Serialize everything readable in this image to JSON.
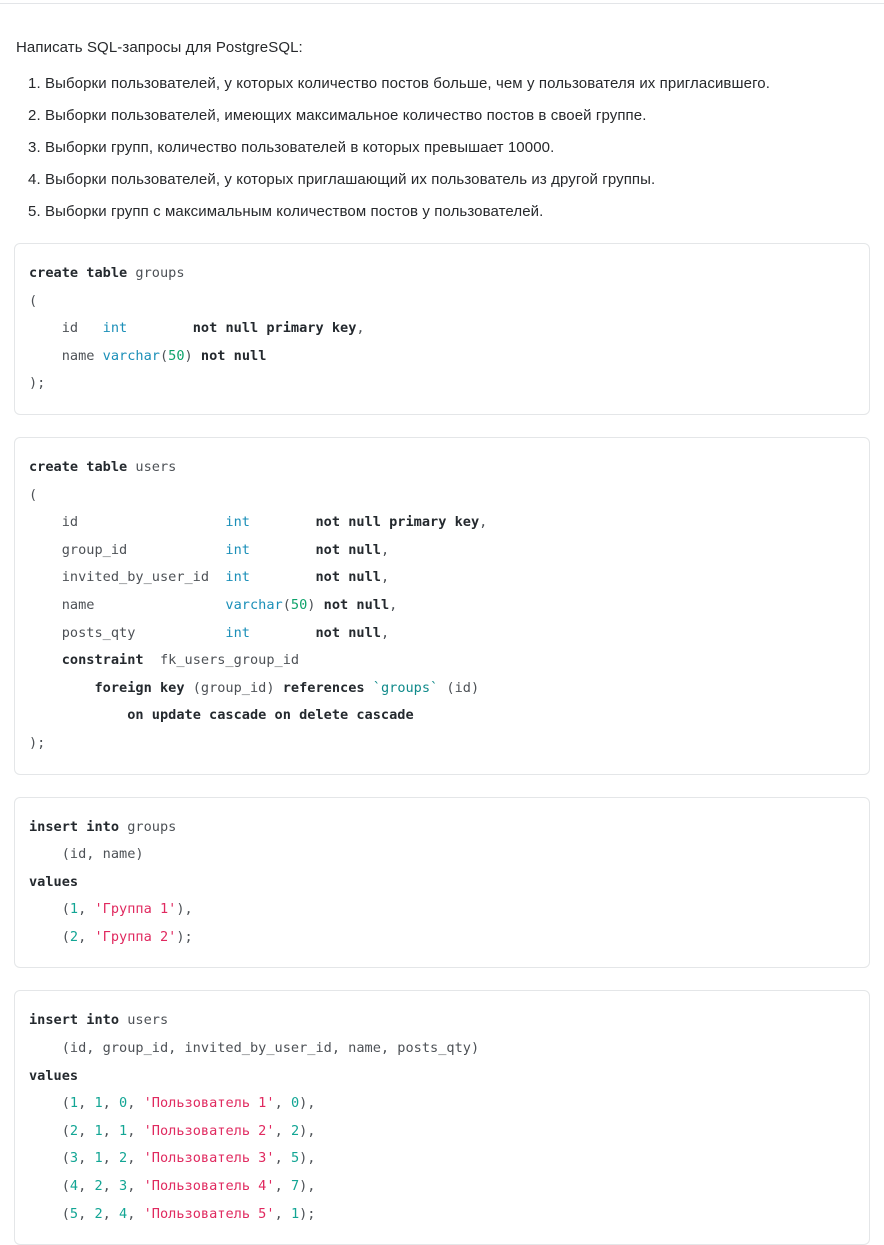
{
  "document": {
    "intro": "Написать SQL-запросы для PostgreSQL:",
    "tasks": [
      "1. Выборки пользователей, у которых количество постов больше, чем у пользователя их пригласившего.",
      "2. Выборки пользователей, имеющих максимальное количество постов в своей группе.",
      "3. Выборки групп, количество пользователей в которых превышает 10000.",
      "4. Выборки пользователей, у которых приглашающий их пользователь из другой группы.",
      "5. Выборки групп с максимальным количеством постов у пользователей."
    ]
  },
  "colors": {
    "keyword": "#24292e",
    "type": "#1b8fb8",
    "number": "#12a594",
    "string": "#e0295f",
    "identifier": "#4d5156",
    "card_border": "#e4e6e8",
    "background": "#ffffff",
    "text": "#26282b"
  },
  "code_blocks": [
    {
      "name": "create-table-groups",
      "language": "sql",
      "plain_text": "create table groups\n(\n    id   int        not null primary key,\n    name varchar(50) not null\n);",
      "lines": [
        [
          {
            "t": "create table",
            "c": "kw"
          },
          {
            "t": " groups",
            "c": "id"
          }
        ],
        [
          {
            "t": "(",
            "c": "pun"
          }
        ],
        [
          {
            "t": "    id   ",
            "c": "id"
          },
          {
            "t": "int",
            "c": "typ"
          },
          {
            "t": "        ",
            "c": "pun"
          },
          {
            "t": "not null primary key",
            "c": "kw"
          },
          {
            "t": ",",
            "c": "pun"
          }
        ],
        [
          {
            "t": "    name ",
            "c": "id"
          },
          {
            "t": "varchar",
            "c": "typ"
          },
          {
            "t": "(",
            "c": "pun"
          },
          {
            "t": "50",
            "c": "num"
          },
          {
            "t": ") ",
            "c": "pun"
          },
          {
            "t": "not null",
            "c": "kw"
          }
        ],
        [
          {
            "t": ");",
            "c": "pun"
          }
        ]
      ]
    },
    {
      "name": "create-table-users",
      "language": "sql",
      "plain_text": "create table users\n(\n    id                  int        not null primary key,\n    group_id            int        not null,\n    invited_by_user_id  int        not null,\n    name                varchar(50) not null,\n    posts_qty           int        not null,\n    constraint  fk_users_group_id\n        foreign key (group_id) references `groups` (id)\n            on update cascade on delete cascade\n);",
      "lines": [
        [
          {
            "t": "create table",
            "c": "kw"
          },
          {
            "t": " users",
            "c": "id"
          }
        ],
        [
          {
            "t": "(",
            "c": "pun"
          }
        ],
        [
          {
            "t": "    id                  ",
            "c": "id"
          },
          {
            "t": "int",
            "c": "typ"
          },
          {
            "t": "        ",
            "c": "pun"
          },
          {
            "t": "not null primary key",
            "c": "kw"
          },
          {
            "t": ",",
            "c": "pun"
          }
        ],
        [
          {
            "t": "    group_id            ",
            "c": "id"
          },
          {
            "t": "int",
            "c": "typ"
          },
          {
            "t": "        ",
            "c": "pun"
          },
          {
            "t": "not null",
            "c": "kw"
          },
          {
            "t": ",",
            "c": "pun"
          }
        ],
        [
          {
            "t": "    invited_by_user_id  ",
            "c": "id"
          },
          {
            "t": "int",
            "c": "typ"
          },
          {
            "t": "        ",
            "c": "pun"
          },
          {
            "t": "not null",
            "c": "kw"
          },
          {
            "t": ",",
            "c": "pun"
          }
        ],
        [
          {
            "t": "    name                ",
            "c": "id"
          },
          {
            "t": "varchar",
            "c": "typ"
          },
          {
            "t": "(",
            "c": "pun"
          },
          {
            "t": "50",
            "c": "num"
          },
          {
            "t": ") ",
            "c": "pun"
          },
          {
            "t": "not null",
            "c": "kw"
          },
          {
            "t": ",",
            "c": "pun"
          }
        ],
        [
          {
            "t": "    posts_qty           ",
            "c": "id"
          },
          {
            "t": "int",
            "c": "typ"
          },
          {
            "t": "        ",
            "c": "pun"
          },
          {
            "t": "not null",
            "c": "kw"
          },
          {
            "t": ",",
            "c": "pun"
          }
        ],
        [
          {
            "t": "    ",
            "c": "pun"
          },
          {
            "t": "constraint",
            "c": "kw"
          },
          {
            "t": "  fk_users_group_id",
            "c": "id"
          }
        ],
        [
          {
            "t": "        ",
            "c": "pun"
          },
          {
            "t": "foreign key",
            "c": "kw"
          },
          {
            "t": " (group_id) ",
            "c": "id"
          },
          {
            "t": "references",
            "c": "kw"
          },
          {
            "t": " ",
            "c": "id"
          },
          {
            "t": "`groups`",
            "c": "tick"
          },
          {
            "t": " (id)",
            "c": "id"
          }
        ],
        [
          {
            "t": "            ",
            "c": "pun"
          },
          {
            "t": "on update cascade on delete cascade",
            "c": "kw"
          }
        ],
        [
          {
            "t": ");",
            "c": "pun"
          }
        ]
      ]
    },
    {
      "name": "insert-into-groups",
      "language": "sql",
      "plain_text": "insert into groups\n    (id, name)\nvalues\n    (1, 'Группа 1'),\n    (2, 'Группа 2');",
      "lines": [
        [
          {
            "t": "insert into",
            "c": "kw"
          },
          {
            "t": " groups",
            "c": "id"
          }
        ],
        [
          {
            "t": "    (id, name)",
            "c": "id"
          }
        ],
        [
          {
            "t": "values",
            "c": "kw"
          }
        ],
        [
          {
            "t": "    (",
            "c": "pun"
          },
          {
            "t": "1",
            "c": "num2"
          },
          {
            "t": ", ",
            "c": "pun"
          },
          {
            "t": "'Группа 1'",
            "c": "str"
          },
          {
            "t": "),",
            "c": "pun"
          }
        ],
        [
          {
            "t": "    (",
            "c": "pun"
          },
          {
            "t": "2",
            "c": "num2"
          },
          {
            "t": ", ",
            "c": "pun"
          },
          {
            "t": "'Группа 2'",
            "c": "str"
          },
          {
            "t": ");",
            "c": "pun"
          }
        ]
      ]
    },
    {
      "name": "insert-into-users",
      "language": "sql",
      "plain_text": "insert into users\n    (id, group_id, invited_by_user_id, name, posts_qty)\nvalues\n    (1, 1, 0, 'Пользователь 1', 0),\n    (2, 1, 1, 'Пользователь 2', 2),\n    (3, 1, 2, 'Пользователь 3', 5),\n    (4, 2, 3, 'Пользователь 4', 7),\n    (5, 2, 4, 'Пользователь 5', 1);",
      "columns": [
        "id",
        "group_id",
        "invited_by_user_id",
        "name",
        "posts_qty"
      ],
      "rows": [
        [
          1,
          1,
          0,
          "Пользователь 1",
          0
        ],
        [
          2,
          1,
          1,
          "Пользователь 2",
          2
        ],
        [
          3,
          1,
          2,
          "Пользователь 3",
          5
        ],
        [
          4,
          2,
          3,
          "Пользователь 4",
          7
        ],
        [
          5,
          2,
          4,
          "Пользователь 5",
          1
        ]
      ],
      "lines": [
        [
          {
            "t": "insert into",
            "c": "kw"
          },
          {
            "t": " users",
            "c": "id"
          }
        ],
        [
          {
            "t": "    (id, group_id, invited_by_user_id, name, posts_qty)",
            "c": "id"
          }
        ],
        [
          {
            "t": "values",
            "c": "kw"
          }
        ],
        [
          {
            "t": "    (",
            "c": "pun"
          },
          {
            "t": "1",
            "c": "num2"
          },
          {
            "t": ", ",
            "c": "pun"
          },
          {
            "t": "1",
            "c": "num2"
          },
          {
            "t": ", ",
            "c": "pun"
          },
          {
            "t": "0",
            "c": "num2"
          },
          {
            "t": ", ",
            "c": "pun"
          },
          {
            "t": "'Пользователь 1'",
            "c": "str"
          },
          {
            "t": ", ",
            "c": "pun"
          },
          {
            "t": "0",
            "c": "num2"
          },
          {
            "t": "),",
            "c": "pun"
          }
        ],
        [
          {
            "t": "    (",
            "c": "pun"
          },
          {
            "t": "2",
            "c": "num2"
          },
          {
            "t": ", ",
            "c": "pun"
          },
          {
            "t": "1",
            "c": "num2"
          },
          {
            "t": ", ",
            "c": "pun"
          },
          {
            "t": "1",
            "c": "num2"
          },
          {
            "t": ", ",
            "c": "pun"
          },
          {
            "t": "'Пользователь 2'",
            "c": "str"
          },
          {
            "t": ", ",
            "c": "pun"
          },
          {
            "t": "2",
            "c": "num2"
          },
          {
            "t": "),",
            "c": "pun"
          }
        ],
        [
          {
            "t": "    (",
            "c": "pun"
          },
          {
            "t": "3",
            "c": "num2"
          },
          {
            "t": ", ",
            "c": "pun"
          },
          {
            "t": "1",
            "c": "num2"
          },
          {
            "t": ", ",
            "c": "pun"
          },
          {
            "t": "2",
            "c": "num2"
          },
          {
            "t": ", ",
            "c": "pun"
          },
          {
            "t": "'Пользователь 3'",
            "c": "str"
          },
          {
            "t": ", ",
            "c": "pun"
          },
          {
            "t": "5",
            "c": "num2"
          },
          {
            "t": "),",
            "c": "pun"
          }
        ],
        [
          {
            "t": "    (",
            "c": "pun"
          },
          {
            "t": "4",
            "c": "num2"
          },
          {
            "t": ", ",
            "c": "pun"
          },
          {
            "t": "2",
            "c": "num2"
          },
          {
            "t": ", ",
            "c": "pun"
          },
          {
            "t": "3",
            "c": "num2"
          },
          {
            "t": ", ",
            "c": "pun"
          },
          {
            "t": "'Пользователь 4'",
            "c": "str"
          },
          {
            "t": ", ",
            "c": "pun"
          },
          {
            "t": "7",
            "c": "num2"
          },
          {
            "t": "),",
            "c": "pun"
          }
        ],
        [
          {
            "t": "    (",
            "c": "pun"
          },
          {
            "t": "5",
            "c": "num2"
          },
          {
            "t": ", ",
            "c": "pun"
          },
          {
            "t": "2",
            "c": "num2"
          },
          {
            "t": ", ",
            "c": "pun"
          },
          {
            "t": "4",
            "c": "num2"
          },
          {
            "t": ", ",
            "c": "pun"
          },
          {
            "t": "'Пользователь 5'",
            "c": "str"
          },
          {
            "t": ", ",
            "c": "pun"
          },
          {
            "t": "1",
            "c": "num2"
          },
          {
            "t": ");",
            "c": "pun"
          }
        ]
      ]
    }
  ]
}
